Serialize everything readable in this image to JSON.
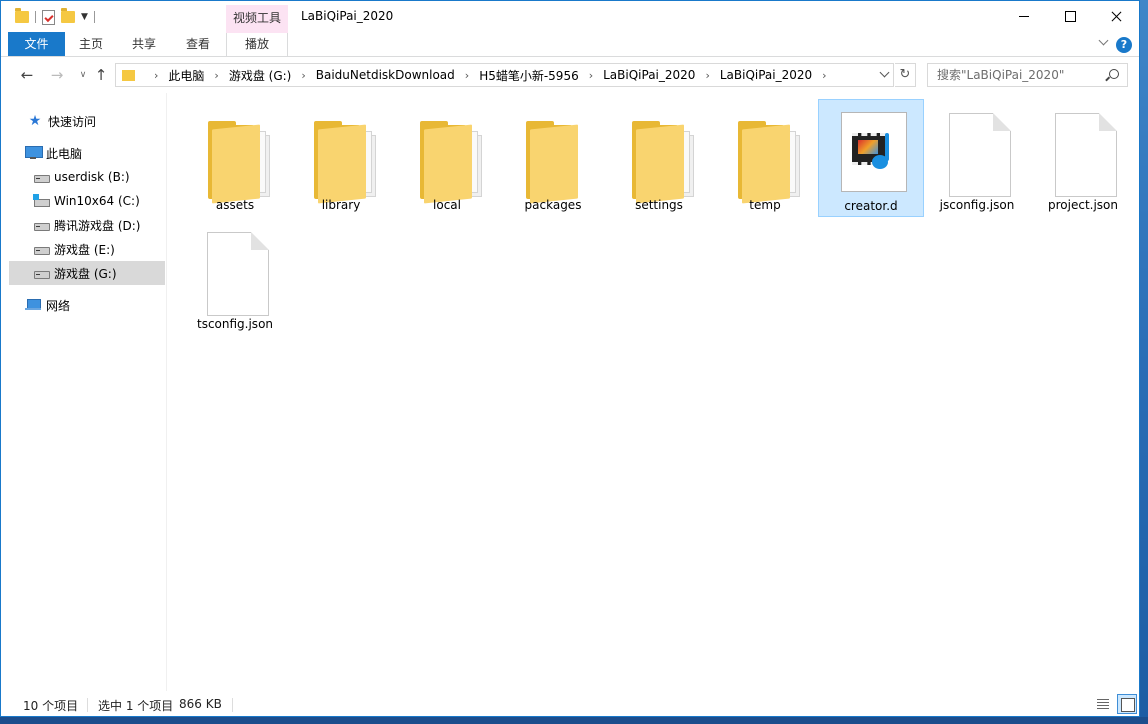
{
  "window": {
    "title": "LaBiQiPai_2020",
    "context_tab_group": "视频工具"
  },
  "ribbon": {
    "tabs": [
      "文件",
      "主页",
      "共享",
      "查看",
      "播放"
    ],
    "help": "?"
  },
  "address": {
    "breadcrumbs": [
      "此电脑",
      "游戏盘 (G:)",
      "BaiduNetdiskDownload",
      "H5蜡笔小新-5956",
      "LaBiQiPai_2020",
      "LaBiQiPai_2020"
    ],
    "search_placeholder": "搜索\"LaBiQiPai_2020\""
  },
  "navpane": {
    "items": [
      {
        "label": "快速访问",
        "icon": "star-icon"
      },
      {
        "label": "此电脑",
        "icon": "pc-icon"
      },
      {
        "label": "userdisk (B:)",
        "icon": "drive-icon"
      },
      {
        "label": "Win10x64 (C:)",
        "icon": "windows-drive-icon"
      },
      {
        "label": "腾讯游戏盘 (D:)",
        "icon": "drive-icon"
      },
      {
        "label": "游戏盘 (E:)",
        "icon": "drive-icon"
      },
      {
        "label": "游戏盘 (G:)",
        "icon": "drive-icon",
        "selected": true
      },
      {
        "label": "网络",
        "icon": "network-icon"
      }
    ]
  },
  "files": [
    {
      "name": "assets",
      "type": "folder"
    },
    {
      "name": "library",
      "type": "folder"
    },
    {
      "name": "local",
      "type": "folder"
    },
    {
      "name": "packages",
      "type": "folder"
    },
    {
      "name": "settings",
      "type": "folder"
    },
    {
      "name": "temp",
      "type": "folder"
    },
    {
      "name": "creator.d",
      "type": "media-file",
      "selected": true
    },
    {
      "name": "jsconfig.json",
      "type": "file"
    },
    {
      "name": "project.json",
      "type": "file"
    },
    {
      "name": "tsconfig.json",
      "type": "file"
    }
  ],
  "status": {
    "item_count": "10 个项目",
    "selected": "选中 1 个项目",
    "size": "866 KB"
  },
  "colors": {
    "accent": "#1979ca",
    "selection": "#cce8ff",
    "context_tab": "#fce3f3"
  }
}
